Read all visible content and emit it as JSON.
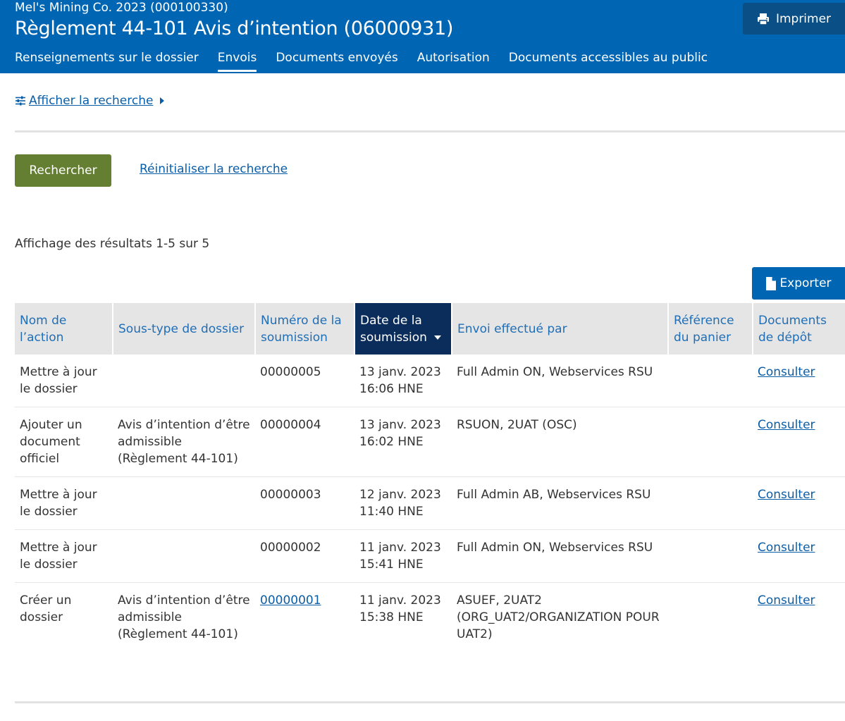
{
  "header": {
    "company": "Mel's Mining Co. 2023 (000100330)",
    "title": "Règlement 44-101 Avis d’intention (06000931)",
    "print_label": "Imprimer",
    "nav": [
      {
        "label": "Renseignements sur le dossier"
      },
      {
        "label": "Envois"
      },
      {
        "label": "Documents envoyés"
      },
      {
        "label": "Autorisation"
      },
      {
        "label": "Documents accessibles au public"
      }
    ]
  },
  "search": {
    "toggle_label": "Afficher la recherche",
    "search_button": "Rechercher",
    "reset_link": "Réinitialiser la recherche"
  },
  "results_text": "Affichage des résultats 1-5 sur 5",
  "export_label": "Exporter",
  "table": {
    "columns": [
      {
        "label": "Nom de l’action"
      },
      {
        "label": "Sous-type de dossier"
      },
      {
        "label": "Numéro de la soumission"
      },
      {
        "label": "Date de la soumission"
      },
      {
        "label": "Envoi effectué par"
      },
      {
        "label": "Référence du panier"
      },
      {
        "label": "Documents de dépôt"
      }
    ],
    "rows": [
      {
        "action": "Mettre à jour le dossier",
        "subtype": "",
        "number": "00000005",
        "date": "13 janv. 2023",
        "time": "16:06 HNE",
        "by": "Full Admin ON, Webservices RSU",
        "ref": "",
        "docs": "Consulter"
      },
      {
        "action": "Ajouter un document officiel",
        "subtype": "Avis d’intention d’être admissible (Règlement 44-101)",
        "number": "00000004",
        "date": "13 janv. 2023",
        "time": "16:02 HNE",
        "by": "RSUON, 2UAT (OSC)",
        "ref": "",
        "docs": "Consulter"
      },
      {
        "action": "Mettre à jour le dossier",
        "subtype": "",
        "number": "00000003",
        "date": "12 janv. 2023",
        "time": "11:40 HNE",
        "by": "Full Admin AB, Webservices RSU",
        "ref": "",
        "docs": "Consulter"
      },
      {
        "action": "Mettre à jour le dossier",
        "subtype": "",
        "number": "00000002",
        "date": "11 janv. 2023",
        "time": "15:41 HNE",
        "by": "Full Admin ON, Webservices RSU",
        "ref": "",
        "docs": "Consulter"
      },
      {
        "action": "Créer un dossier",
        "subtype": "Avis d’intention d’être admissible (Règlement 44-101)",
        "number": "00000001",
        "date": "11 janv. 2023",
        "time": "15:38 HNE",
        "by": "ASUEF, 2UAT2 (ORG_UAT2/ORGANIZATION POUR UAT2)",
        "ref": "",
        "docs": "Consulter"
      }
    ]
  },
  "colors": {
    "header_bg": "#0066b3",
    "print_bg": "#0a4f86",
    "search_button_bg": "#647f32",
    "sorted_header_bg": "#0b2d5b",
    "link": "#0a5ea8"
  },
  "icons": {
    "print": "printer-icon",
    "filter": "sliders-icon",
    "export": "file-icon"
  }
}
